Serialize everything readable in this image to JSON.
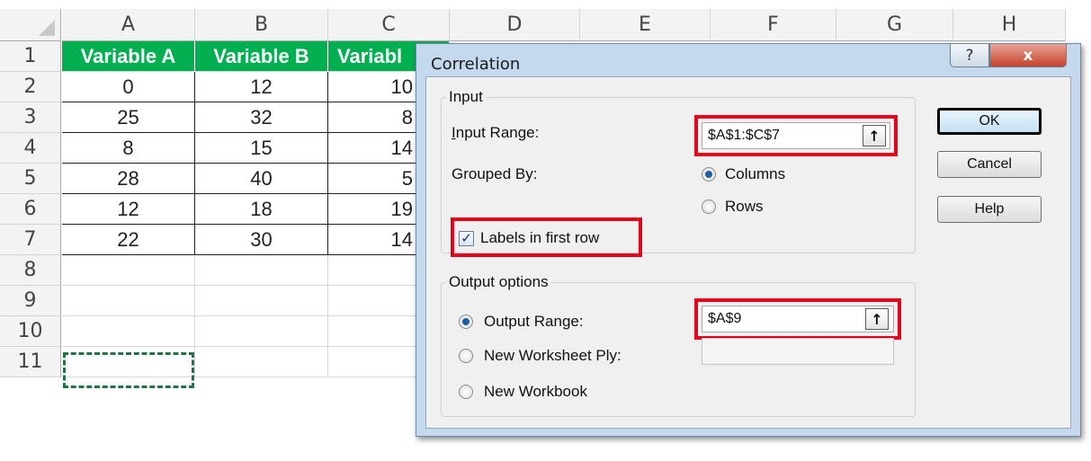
{
  "sheet": {
    "columns": [
      "A",
      "B",
      "C",
      "D",
      "E",
      "F",
      "G",
      "H"
    ],
    "rows": [
      "1",
      "2",
      "3",
      "4",
      "5",
      "6",
      "7",
      "8",
      "9",
      "10",
      "11"
    ],
    "headers": [
      "Variable A",
      "Variable B",
      "Variabl"
    ],
    "data": [
      [
        "0",
        "12",
        "10"
      ],
      [
        "25",
        "32",
        "8"
      ],
      [
        "8",
        "15",
        "14"
      ],
      [
        "28",
        "40",
        "5"
      ],
      [
        "12",
        "18",
        "19"
      ],
      [
        "22",
        "30",
        "14"
      ]
    ],
    "colors": {
      "header_fill": "#00b050",
      "selection_border": "#217346"
    }
  },
  "dialog": {
    "title": "Correlation",
    "help_icon": "?",
    "close_icon": "x",
    "input_group": "Input",
    "input_range_label": "Input Range:",
    "input_range_value": "$A$1:$C$7",
    "grouped_by_label": "Grouped By:",
    "columns_label": "Columns",
    "rows_label": "Rows",
    "labels_first_row": "Labels in first row",
    "labels_checked": true,
    "grouped_by_selected": "Columns",
    "output_group": "Output options",
    "output_range_label": "Output Range:",
    "output_range_value": "$A$9",
    "new_ply_label": "New Worksheet Ply:",
    "new_ply_value": "",
    "new_workbook_label": "New Workbook",
    "output_selected": "Output Range",
    "ok_label": "OK",
    "cancel_label": "Cancel",
    "help_label": "Help",
    "picker_icon": "↑",
    "colors": {
      "highlight": "#e3001b",
      "radio_dot": "#1c5ea6"
    }
  }
}
